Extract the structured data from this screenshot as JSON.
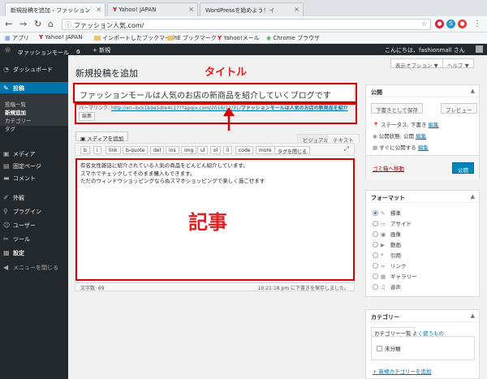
{
  "browser": {
    "tabs": [
      {
        "label": "新規投稿を追加 ‹ ファッション"
      },
      {
        "label": "Yahoo! JAPAN"
      },
      {
        "label": "WordPressを始めよう！イ"
      }
    ],
    "url": "ファッション人気.com/",
    "bookmarks": [
      "アプリ",
      "Yahoo! JAPAN",
      "インポートしたブックマーク",
      "IE ブックマーク",
      "Yahoo!メール",
      "Chrome ブラウザ"
    ]
  },
  "adminbar": {
    "site_name": "ファッションモール",
    "comments": "0",
    "new": "+ 新規",
    "greeting": "こんにちは、fashionmall さん"
  },
  "sidebar": {
    "items": [
      {
        "label": "ダッシュボード",
        "icon": "dashboard-icon"
      },
      {
        "label": "投稿",
        "icon": "pin-icon"
      },
      {
        "label": "メディア",
        "icon": "media-icon"
      },
      {
        "label": "固定ページ",
        "icon": "page-icon"
      },
      {
        "label": "コメント",
        "icon": "comment-icon"
      },
      {
        "label": "外観",
        "icon": "brush-icon"
      },
      {
        "label": "プラグイン",
        "icon": "plugin-icon"
      },
      {
        "label": "ユーザー",
        "icon": "user-icon"
      },
      {
        "label": "ツール",
        "icon": "wrench-icon"
      },
      {
        "label": "設定",
        "icon": "settings-icon"
      },
      {
        "label": "メニューを閉じる",
        "icon": "collapse-icon"
      }
    ],
    "submenu": [
      "投稿一覧",
      "新規追加",
      "カテゴリー",
      "タグ"
    ]
  },
  "header": {
    "title": "新規投稿を追加",
    "screen_options": "表示オプション ▼",
    "help": "ヘルプ ▼"
  },
  "post": {
    "title": "ファッションモールは人気のお店の新商品を紹介していくブログです",
    "permalink_label": "パーマリンク:",
    "permalink_url": "http://xn--bck1b9a5dre4c1???apqix.com/2016/12/31/",
    "permalink_slug": "ファッションモールは人気のお店の新商品を紹介",
    "edit_label": "編集",
    "add_media": "メディアを追加",
    "tab_visual": "ビジュアル",
    "tab_text": "テキスト",
    "quicktags": [
      "b",
      "i",
      "link",
      "b-quote",
      "del",
      "ins",
      "img",
      "ul",
      "ol",
      "li",
      "code",
      "more",
      "タグを閉じる"
    ],
    "content_lines": [
      "有名女性雑誌に紹介されている人気の商品をどんどん紹介しています。",
      "スマホでチェックしてそのまま購入もできます。",
      "ただのウィンドウショッピングならぬスマホショッピングで楽しく過ごせます"
    ],
    "word_count": "文字数: 69",
    "saved_at": "10:21:18 pm に下書きを保存しました。"
  },
  "annotations": {
    "title_label": "タイトル",
    "body_label": "記事",
    "color": "#d60000"
  },
  "publish": {
    "heading": "公開",
    "save_draft": "下書きとして保存",
    "preview": "プレビュー",
    "status": "ステータス: 下書き",
    "visibility": "公開状態: 公開",
    "schedule": "すぐに公開する",
    "edit": "編集",
    "trash": "ゴミ箱へ移動",
    "publish": "公開"
  },
  "format": {
    "heading": "フォーマット",
    "options": [
      {
        "label": "標準",
        "icon": "pin-icon",
        "checked": true
      },
      {
        "label": "アサイド",
        "icon": "aside-icon",
        "checked": false
      },
      {
        "label": "画像",
        "icon": "image-icon",
        "checked": false
      },
      {
        "label": "動画",
        "icon": "video-icon",
        "checked": false
      },
      {
        "label": "引用",
        "icon": "quote-icon",
        "checked": false
      },
      {
        "label": "リンク",
        "icon": "link-icon",
        "checked": false
      },
      {
        "label": "ギャラリー",
        "icon": "gallery-icon",
        "checked": false
      },
      {
        "label": "音声",
        "icon": "audio-icon",
        "checked": false
      }
    ]
  },
  "category": {
    "heading": "カテゴリー",
    "tab_all": "カテゴリー一覧",
    "tab_popular": "よく使うもの",
    "items": [
      "未分類"
    ],
    "add_new": "+ 新規カテゴリーを追加"
  }
}
